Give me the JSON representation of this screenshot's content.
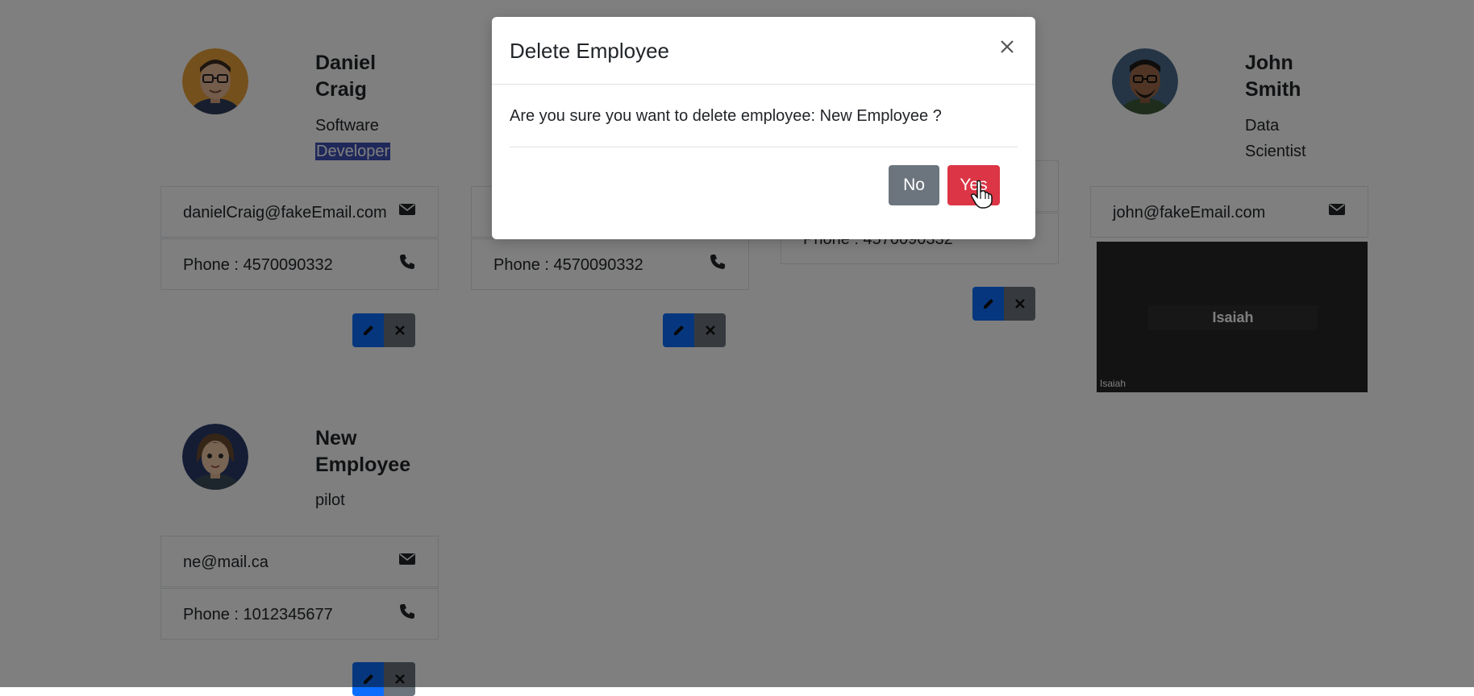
{
  "employees": [
    {
      "name_line1": "Daniel",
      "name_line2": "Craig",
      "role_line1": "Software",
      "role_line2": "Developer",
      "email": "danielCraig@fakeEmail.com",
      "phone": "Phone : 4570090332",
      "avatar_icon": "cartoon-man-glasses-avatar"
    },
    {
      "phone": "Phone : 4570090332"
    },
    {
      "phone": "Phone : 4570090332"
    },
    {
      "name_line1": "John",
      "name_line2": "Smith",
      "role_line1": "Data",
      "role_line2": "Scientist",
      "email": "john@fakeEmail.com",
      "avatar_icon": "cartoon-man-beard-avatar"
    },
    {
      "name_line1": "New",
      "name_line2": "Employee",
      "role_line1": "pilot",
      "email": "ne@mail.ca",
      "phone": "Phone : 1012345677",
      "avatar_icon": "cartoon-woman-avatar"
    }
  ],
  "video_tile": {
    "name": "Isaiah",
    "small_label": "Isaiah"
  },
  "modal": {
    "title": "Delete Employee",
    "message": "Are you sure you want to delete employee: New Employee ?",
    "no_label": "No",
    "yes_label": "Yes"
  },
  "icons": {
    "email": "envelope-icon",
    "phone": "phone-icon",
    "edit": "pencil-icon",
    "delete": "x-icon",
    "close": "close-icon",
    "cursor": "hand-pointer-icon"
  },
  "colors": {
    "primary": "#0d6efd",
    "secondary": "#6c757d",
    "danger": "#dc3545",
    "highlight": "#3f51b5"
  }
}
